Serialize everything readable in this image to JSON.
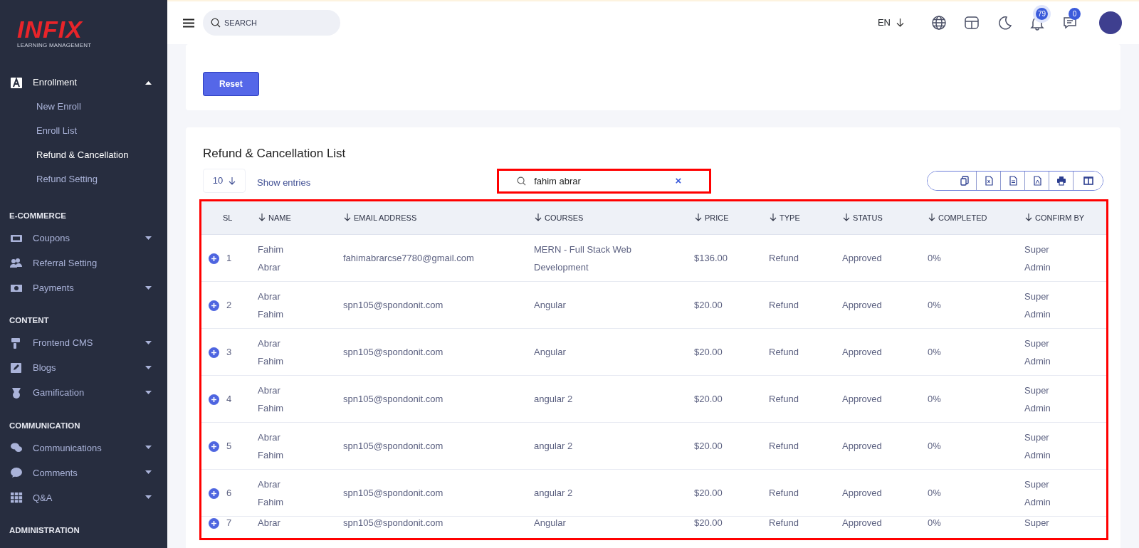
{
  "sidebar": {
    "logo": {
      "title": "INFIX",
      "subtitle": "LEARNING MANAGEMENT"
    },
    "groups": [
      {
        "items": [
          {
            "label": "Enrollment",
            "kind": "dropdown",
            "expanded": true,
            "children": [
              {
                "label": "New Enroll",
                "selected": false
              },
              {
                "label": "Enroll List",
                "selected": false
              },
              {
                "label": "Refund & Cancellation",
                "selected": true
              },
              {
                "label": "Refund Setting",
                "selected": false
              }
            ]
          }
        ]
      },
      {
        "heading": "E-COMMERCE",
        "items": [
          {
            "label": "Coupons",
            "kind": "dropdown",
            "expanded": false
          },
          {
            "label": "Referral Setting",
            "kind": "link"
          },
          {
            "label": "Payments",
            "kind": "dropdown",
            "expanded": false
          }
        ]
      },
      {
        "heading": "CONTENT",
        "items": [
          {
            "label": "Frontend CMS",
            "kind": "dropdown",
            "expanded": false
          },
          {
            "label": "Blogs",
            "kind": "dropdown",
            "expanded": false
          },
          {
            "label": "Gamification",
            "kind": "dropdown",
            "expanded": false
          }
        ]
      },
      {
        "heading": "COMMUNICATION",
        "items": [
          {
            "label": "Communications",
            "kind": "dropdown",
            "expanded": false
          },
          {
            "label": "Comments",
            "kind": "dropdown",
            "expanded": false
          },
          {
            "label": "Q&A",
            "kind": "dropdown",
            "expanded": false
          }
        ]
      },
      {
        "heading": "ADMINISTRATION"
      }
    ]
  },
  "topbar": {
    "search": {
      "placeholder": "SEARCH"
    },
    "language": "EN",
    "notifications": "79",
    "messages": "0"
  },
  "filter_card": {
    "button": "Reset"
  },
  "list_card": {
    "title": "Refund & Cancellation List",
    "page_length": "10",
    "page_length_label": "Show entries",
    "search": {
      "value": "fahim abrar",
      "clear": "×",
      "highlighted": true
    },
    "table": {
      "highlighted": true,
      "columns": [
        {
          "label": "SL",
          "sortable": false
        },
        {
          "label": "NAME",
          "sortable": true
        },
        {
          "label": "EMAIL ADDRESS",
          "sortable": true
        },
        {
          "label": "COURSES",
          "sortable": true
        },
        {
          "label": "PRICE",
          "sortable": true
        },
        {
          "label": "TYPE",
          "sortable": true
        },
        {
          "label": "STATUS",
          "sortable": true
        },
        {
          "label": "COMPLETED",
          "sortable": true
        },
        {
          "label": "CONFIRM BY",
          "sortable": true
        }
      ],
      "rows": [
        [
          "1",
          "Fahim Abrar",
          "fahimabrarcse7780@gmail.com",
          "MERN - Full Stack Web Development",
          "$136.00",
          "Refund",
          "Approved",
          "0%",
          "Super Admin"
        ],
        [
          "2",
          "Abrar Fahim",
          "spn105@spondonit.com",
          "Angular",
          "$20.00",
          "Refund",
          "Approved",
          "0%",
          "Super Admin"
        ],
        [
          "3",
          "Abrar Fahim",
          "spn105@spondonit.com",
          "Angular",
          "$20.00",
          "Refund",
          "Approved",
          "0%",
          "Super Admin"
        ],
        [
          "4",
          "Abrar Fahim",
          "spn105@spondonit.com",
          "angular 2",
          "$20.00",
          "Refund",
          "Approved",
          "0%",
          "Super Admin"
        ],
        [
          "5",
          "Abrar Fahim",
          "spn105@spondonit.com",
          "angular 2",
          "$20.00",
          "Refund",
          "Approved",
          "0%",
          "Super Admin"
        ],
        [
          "6",
          "Abrar Fahim",
          "spn105@spondonit.com",
          "angular 2",
          "$20.00",
          "Refund",
          "Approved",
          "0%",
          "Super Admin"
        ],
        [
          "7",
          "Abrar",
          "spn105@spondonit.com",
          "Angular",
          "$20.00",
          "Refund",
          "Approved",
          "0%",
          "Super"
        ]
      ]
    }
  }
}
